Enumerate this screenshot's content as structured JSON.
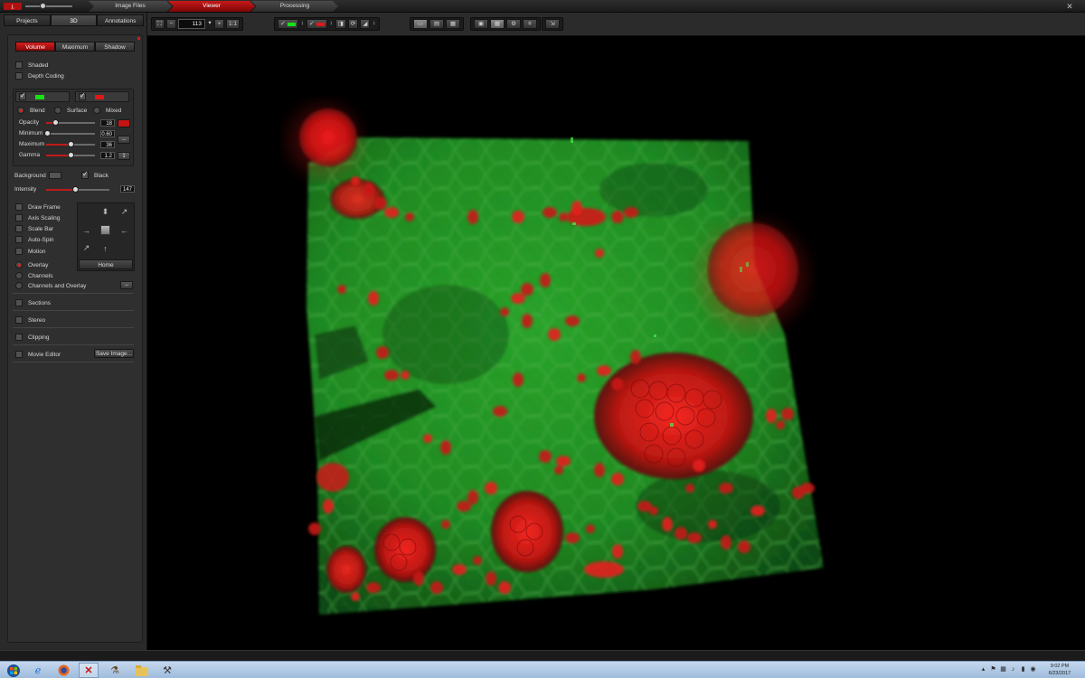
{
  "workflow_tabs": [
    {
      "label": "Image Files",
      "active": false
    },
    {
      "label": "Viewer",
      "active": true
    },
    {
      "label": "Processing",
      "active": false
    }
  ],
  "main_tabs": [
    {
      "label": "Projects",
      "active": false
    },
    {
      "label": "3D",
      "active": true
    },
    {
      "label": "Annotations",
      "active": false
    }
  ],
  "render_tabs": [
    {
      "label": "Volume",
      "active": true
    },
    {
      "label": "Maximum",
      "active": false
    },
    {
      "label": "Shadow",
      "active": false
    }
  ],
  "options": {
    "shaded": "Shaded",
    "depth_coding": "Depth Coding"
  },
  "channels": [
    {
      "checked": true,
      "color": "#18e018"
    },
    {
      "checked": true,
      "color": "#e01818"
    }
  ],
  "blend_modes": {
    "blend": "Blend",
    "surface": "Surface",
    "mixed": "Mixed",
    "selected": "Blend"
  },
  "sliders": {
    "opacity": {
      "label": "Opacity",
      "value": "18",
      "fraction": 0.18
    },
    "minimum": {
      "label": "Minimum",
      "value": "0.60",
      "fraction": 0.02
    },
    "maximum": {
      "label": "Maximum",
      "value": "36",
      "fraction": 0.5
    },
    "gamma": {
      "label": "Gamma",
      "value": "1.2",
      "fraction": 0.5
    }
  },
  "mini_buttons": {
    "dash": "--",
    "one": "1"
  },
  "background": {
    "label": "Background",
    "black_label": "Black",
    "black_checked": true
  },
  "intensity": {
    "label": "Intensity",
    "value": "147",
    "fraction": 0.45
  },
  "display_options": [
    {
      "label": "Draw Frame",
      "checked": false
    },
    {
      "label": "Axis Scaling",
      "checked": false
    },
    {
      "label": "Scale Bar",
      "checked": false
    },
    {
      "label": "Auto-Spin",
      "checked": false
    },
    {
      "label": "Motion",
      "checked": false
    }
  ],
  "overlay_options": [
    {
      "label": "Overlay",
      "selected": true
    },
    {
      "label": "Channels",
      "selected": false
    },
    {
      "label": "Channels and Overlay",
      "selected": false
    }
  ],
  "nav_pad": {
    "home_label": "Home"
  },
  "sections": {
    "sections": "Sections",
    "stereo": "Stereo",
    "clipping": "Clipping",
    "movie_editor": "Movie Editor",
    "save_image": "Save Image..."
  },
  "viewer_toolbar": {
    "zoom_value": "113",
    "minus": "−",
    "plus": "+",
    "one_to_one": "1:1"
  },
  "clock": {
    "time": "9:02 PM",
    "date": "6/23/2017"
  },
  "colors": {
    "accent_red": "#c81a1a",
    "channel_green": "#18e018",
    "channel_red": "#e01818"
  }
}
